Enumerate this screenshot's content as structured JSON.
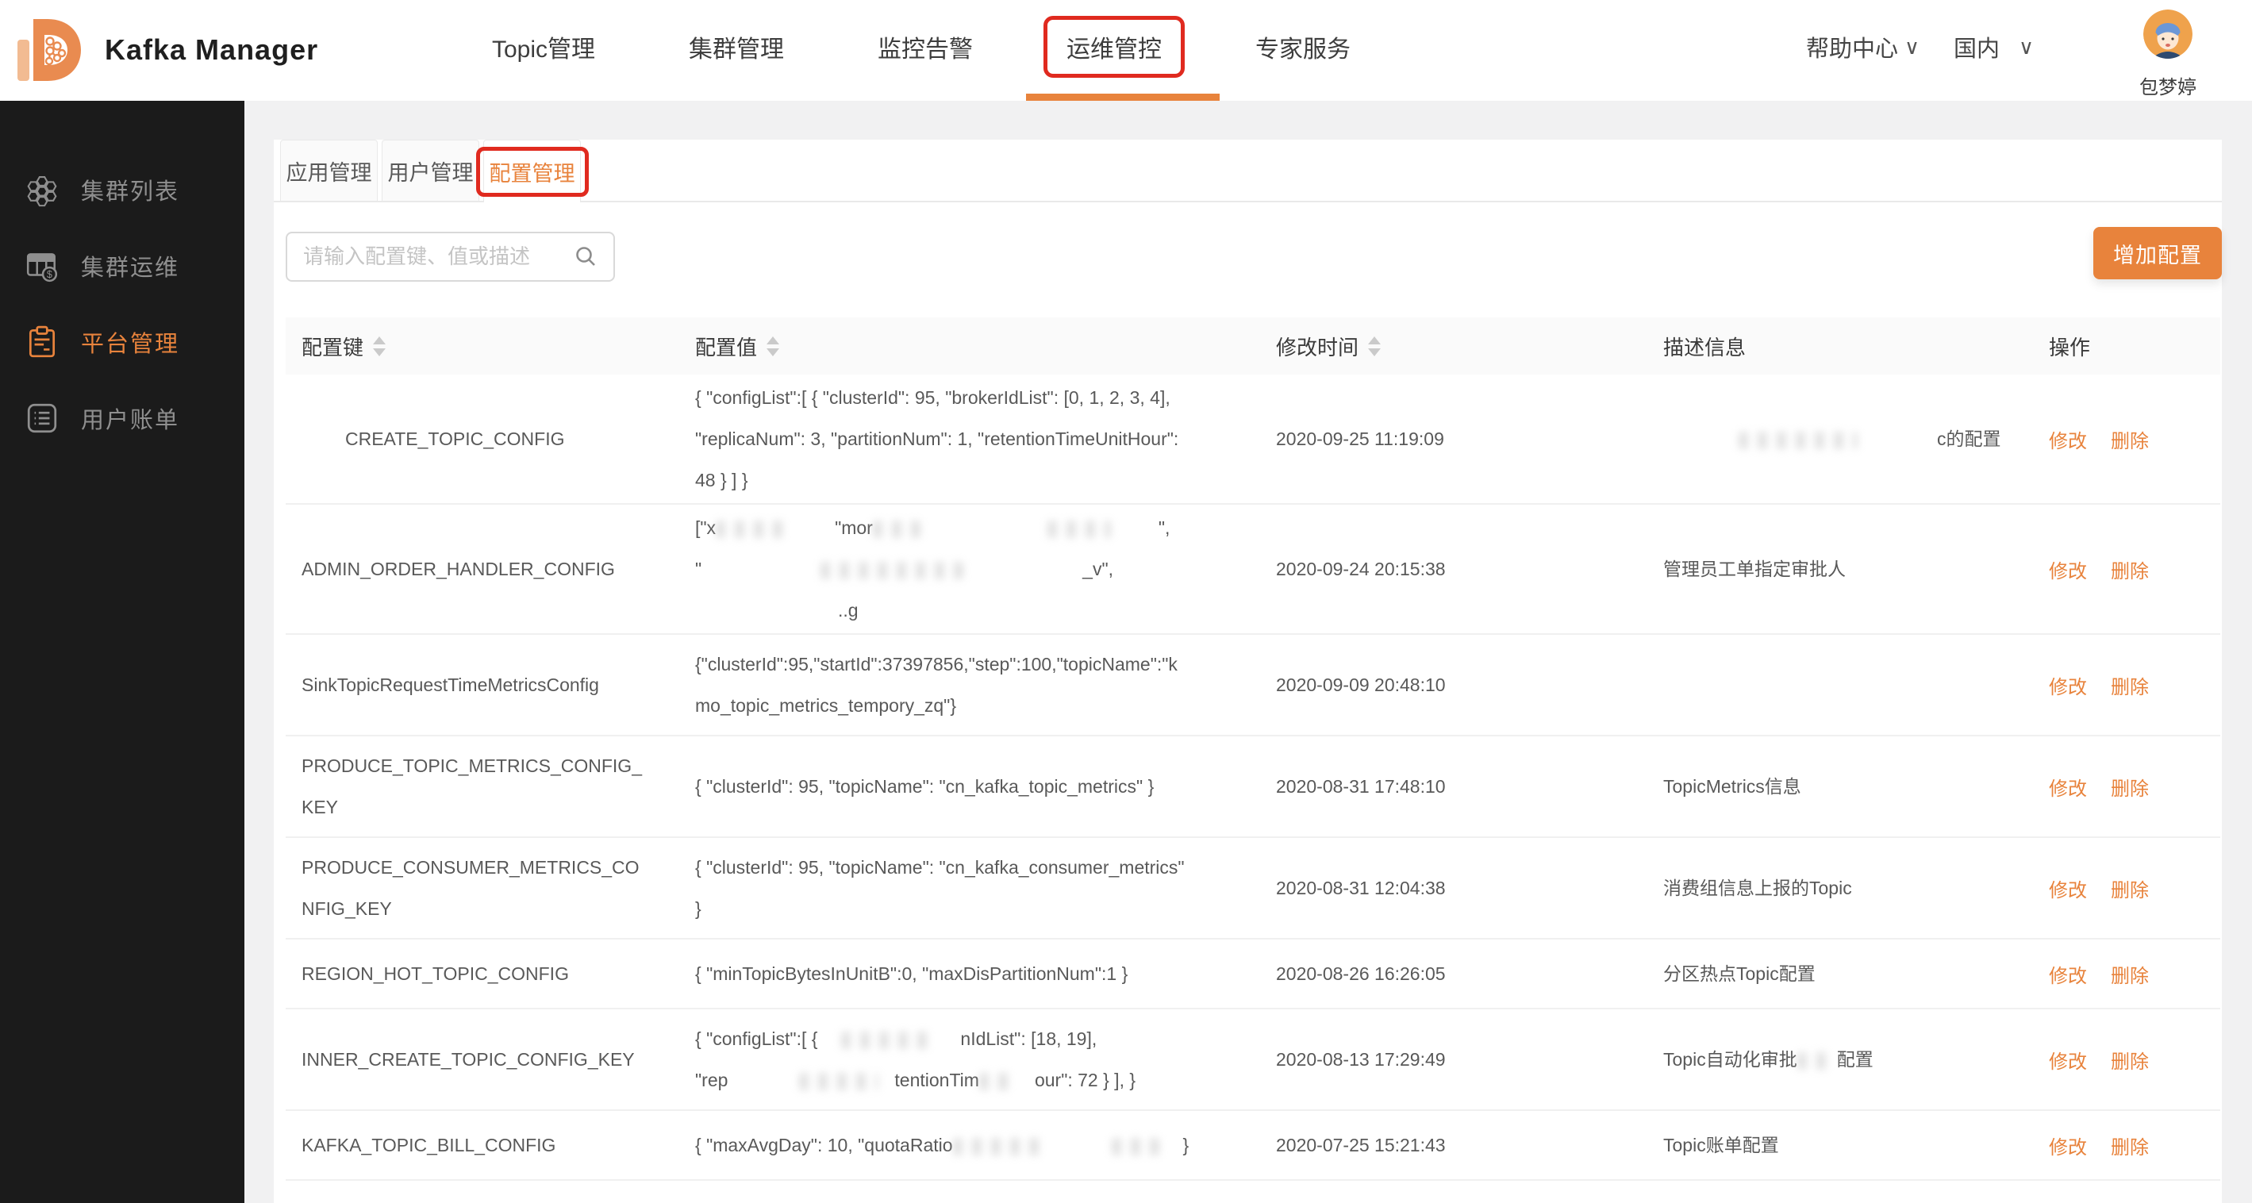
{
  "colors": {
    "accent_orange": "#e8833c",
    "annotation_red": "#e02a1f",
    "sidebar_bg": "#1b1b1b",
    "table_header_bg": "#fafafa"
  },
  "header": {
    "title": "Kafka Manager",
    "nav": [
      {
        "label": "Topic管理"
      },
      {
        "label": "集群管理"
      },
      {
        "label": "监控告警"
      },
      {
        "label": "运维管控",
        "active": true,
        "annotated": true
      },
      {
        "label": "专家服务"
      }
    ],
    "help_label": "帮助中心",
    "region_label": "国内",
    "caret_glyph": "∨",
    "user_name": "包梦婷"
  },
  "sidebar": {
    "items": [
      {
        "id": "cluster-list",
        "label": "集群列表",
        "icon": "hexagon-cluster-icon",
        "active": false
      },
      {
        "id": "cluster-ops",
        "label": "集群运维",
        "icon": "grid-dollar-icon",
        "active": false
      },
      {
        "id": "platform-admin",
        "label": "平台管理",
        "icon": "clipboard-icon",
        "active": true
      },
      {
        "id": "user-billing",
        "label": "用户账单",
        "icon": "list-icon",
        "active": false
      }
    ]
  },
  "tabs": [
    {
      "label": "应用管理",
      "active": false
    },
    {
      "label": "用户管理",
      "active": false
    },
    {
      "label": "配置管理",
      "active": true,
      "annotated": true
    }
  ],
  "search": {
    "placeholder": "请输入配置键、值或描述"
  },
  "toolbar": {
    "add_label": "增加配置"
  },
  "table": {
    "columns": [
      {
        "label": "配置键",
        "sortable": true
      },
      {
        "label": "配置值",
        "sortable": true
      },
      {
        "label": "修改时间",
        "sortable": true
      },
      {
        "label": "描述信息",
        "sortable": false
      },
      {
        "label": "操作",
        "sortable": false
      }
    ],
    "actions": [
      "修改",
      "删除"
    ],
    "rows": [
      {
        "key": [
          [
            {
              "g": 55
            },
            "CREATE_TOPIC_CONFIG"
          ]
        ],
        "value": [
          [
            "{ \"configList\":[ { \"clusterId\": 95, \"brokerIdList\": [0, 1, 2, 3, 4],"
          ],
          [
            "\"replicaNum\": 3, \"partitionNum\": 1, \"retentionTimeUnitHour\":"
          ],
          [
            "48 } ] }"
          ]
        ],
        "time": "2020-09-25 11:19:09",
        "desc": [
          [
            {
              "g": 95
            },
            {
              "s": 150
            },
            {
              "g": 100
            },
            "c的配置"
          ]
        ]
      },
      {
        "key": [
          [
            "ADMIN_ORDER_HANDLER_CONFIG"
          ]
        ],
        "value": [
          [
            "[\"x",
            {
              "s": 90
            },
            {
              "g": 60
            },
            "\"mor",
            {
              "s": 60
            },
            {
              "g": 160
            },
            {
              "s": 80
            },
            {
              "g": 60
            },
            "\","
          ],
          [
            "\"",
            {
              "g": 150
            },
            {
              "s": 180
            },
            {
              "g": 150
            },
            "_v\","
          ],
          [
            {
              "g": 180
            },
            "..g"
          ]
        ],
        "time": "2020-09-24 20:15:38",
        "desc": [
          [
            "管理员工单指定审批人"
          ]
        ]
      },
      {
        "key": [
          [
            "SinkTopicRequestTimeMetricsConfig"
          ]
        ],
        "value": [
          [
            "{\"clusterId\":95,\"startId\":37397856,\"step\":100,\"topicName\":\"k"
          ],
          [
            "mo_topic_metrics_tempory_zq\"}"
          ]
        ],
        "time": "2020-09-09 20:48:10",
        "desc": []
      },
      {
        "key": [
          [
            "PRODUCE_TOPIC_METRICS_CONFIG_"
          ],
          [
            "KEY"
          ]
        ],
        "value": [
          [
            "{ \"clusterId\": 95, \"topicName\": \"cn_kafka_topic_metrics\" }"
          ]
        ],
        "time": "2020-08-31 17:48:10",
        "desc": [
          [
            "TopicMetrics信息"
          ]
        ]
      },
      {
        "key": [
          [
            "PRODUCE_CONSUMER_METRICS_CO"
          ],
          [
            "NFIG_KEY"
          ]
        ],
        "value": [
          [
            "{ \"clusterId\": 95, \"topicName\": \"cn_kafka_consumer_metrics\""
          ],
          [
            "}"
          ]
        ],
        "time": "2020-08-31 12:04:38",
        "desc": [
          [
            "消费组信息上报的Topic"
          ]
        ]
      },
      {
        "key": [
          [
            "REGION_HOT_TOPIC_CONFIG"
          ]
        ],
        "value": [
          [
            "{ \"minTopicBytesInUnitB\":0, \"maxDisPartitionNum\":1 }"
          ]
        ],
        "time": "2020-08-26 16:26:05",
        "desc": [
          [
            "分区热点Topic配置"
          ]
        ]
      },
      {
        "key": [
          [
            "INNER_CREATE_TOPIC_CONFIG_KEY"
          ]
        ],
        "value": [
          [
            "{ \"configList\":[ {",
            {
              "g": 30
            },
            {
              "s": 110
            },
            {
              "g": 40
            },
            "nIdList\": [18, 19],"
          ],
          [
            "\"rep",
            {
              "g": 90
            },
            {
              "s": 100
            },
            {
              "g": 20
            },
            "tentionTim",
            {
              "s": 40
            },
            {
              "g": 30
            },
            "our\": 72 } ], }"
          ]
        ],
        "time": "2020-08-13 17:29:49",
        "desc": [
          [
            "Topic自动化审批",
            {
              "s": 40
            },
            {
              "g": 10
            },
            "配置"
          ]
        ]
      },
      {
        "key": [
          [
            "KAFKA_TOPIC_BILL_CONFIG"
          ]
        ],
        "value": [
          [
            "{ \"maxAvgDay\": 10, \"quotaRatio",
            {
              "s": 120
            },
            {
              "g": 80
            },
            {
              "s": 60
            },
            {
              "g": 30
            },
            "}"
          ]
        ],
        "time": "2020-07-25 15:21:43",
        "desc": [
          [
            "Topic账单配置"
          ]
        ]
      }
    ]
  }
}
